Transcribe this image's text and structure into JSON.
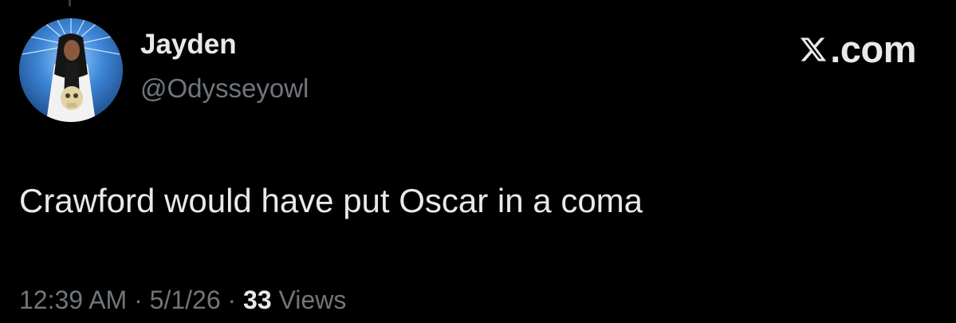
{
  "tweet": {
    "author": {
      "display_name": "Jayden",
      "handle": "@Odysseyowl",
      "avatar_icon": "profile-avatar"
    },
    "brand": {
      "icon": "x-logo",
      "domain_text": ".com"
    },
    "text": "Crawford would have put Oscar in a coma",
    "meta": {
      "time": "12:39 AM",
      "separator": "·",
      "date": "5/1/26",
      "views_count": "33",
      "views_label": "Views"
    }
  },
  "colors": {
    "background": "#000000",
    "primary_text": "#e7e9ea",
    "secondary_text": "#71767b",
    "avatar_bg": "#1e5fa8"
  }
}
